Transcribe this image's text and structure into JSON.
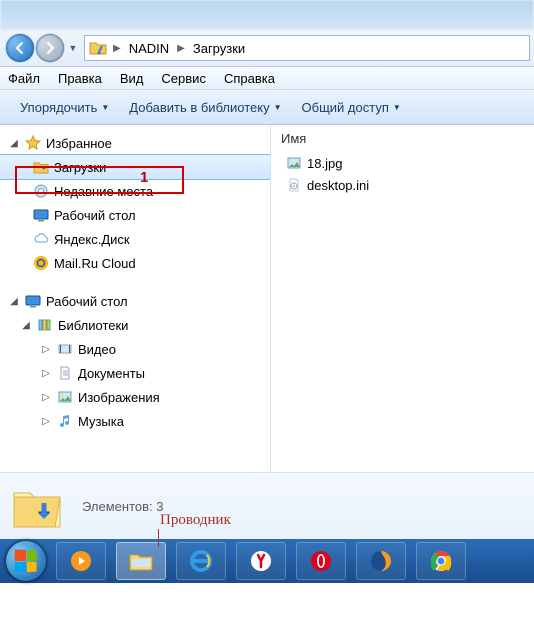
{
  "breadcrumb": {
    "root": "NADIN",
    "current": "Загрузки"
  },
  "menu": {
    "file": "Файл",
    "edit": "Правка",
    "view": "Вид",
    "service": "Сервис",
    "help": "Справка"
  },
  "toolbar": {
    "organize": "Упорядочить",
    "addlib": "Добавить в библиотеку",
    "share": "Общий доступ"
  },
  "tree": {
    "favorites": "Избранное",
    "downloads": "Загрузки",
    "recent": "Недавние места",
    "desktop": "Рабочий стол",
    "yadisk": "Яндекс.Диск",
    "mailru": "Mail.Ru Cloud",
    "desktop2": "Рабочий стол",
    "libraries": "Библиотеки",
    "video": "Видео",
    "docs": "Документы",
    "images": "Изображения",
    "music": "Музыка"
  },
  "content": {
    "col_name": "Имя",
    "files": [
      {
        "name": "18.jpg",
        "icon": "image"
      },
      {
        "name": "desktop.ini",
        "icon": "gear"
      }
    ]
  },
  "status": {
    "text": "Элементов: 3"
  },
  "annotation": {
    "num": "1",
    "provod": "Проводник"
  }
}
